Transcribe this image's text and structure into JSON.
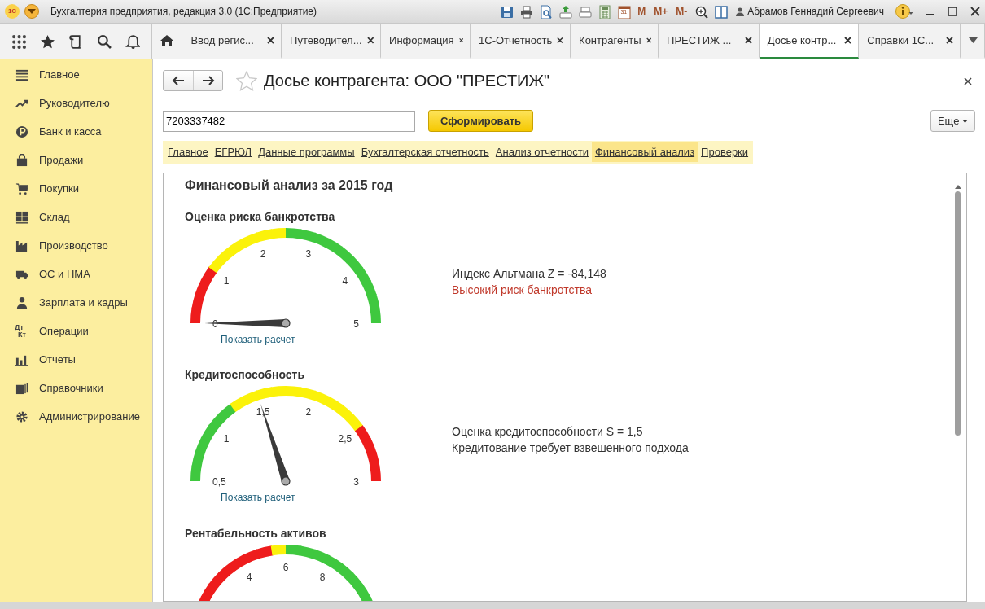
{
  "window": {
    "logo": "1С",
    "title": "Бухгалтерия предприятия, редакция 3.0  (1С:Предприятие)",
    "user": "Абрамов Геннадий Сергеевич"
  },
  "toolbar": [
    {
      "kind": "save"
    },
    {
      "kind": "print"
    },
    {
      "kind": "preview"
    },
    {
      "kind": "export"
    },
    {
      "kind": "scan"
    },
    {
      "kind": "calculator"
    },
    {
      "kind": "calendar",
      "text": "31"
    },
    {
      "kind": "memory",
      "text": "M"
    },
    {
      "kind": "memory",
      "text": "M+"
    },
    {
      "kind": "memory",
      "text": "M-"
    },
    {
      "kind": "zoom"
    },
    {
      "kind": "panel"
    }
  ],
  "section_tools": [
    {
      "kind": "apps"
    },
    {
      "kind": "star"
    },
    {
      "kind": "history"
    },
    {
      "kind": "search"
    },
    {
      "kind": "bell"
    }
  ],
  "tabs": [
    {
      "label": "Ввод регис...",
      "selected": false
    },
    {
      "label": "Путеводител...",
      "selected": false
    },
    {
      "label": "Информация",
      "selected": false
    },
    {
      "label": "1С-Отчетность",
      "selected": false
    },
    {
      "label": "Контрагенты",
      "selected": false
    },
    {
      "label": "ПРЕСТИЖ ...",
      "selected": false
    },
    {
      "label": "Досье контр...",
      "selected": true
    },
    {
      "label": "Справки 1С...",
      "selected": false
    }
  ],
  "sidebar": {
    "items": [
      {
        "label": "Главное",
        "kind": "list"
      },
      {
        "label": "Руководителю",
        "kind": "trend"
      },
      {
        "label": "Банк и касса",
        "kind": "ruble"
      },
      {
        "label": "Продажи",
        "kind": "bag"
      },
      {
        "label": "Покупки",
        "kind": "cart"
      },
      {
        "label": "Склад",
        "kind": "grid"
      },
      {
        "label": "Производство",
        "kind": "factory"
      },
      {
        "label": "ОС и НМА",
        "kind": "truck"
      },
      {
        "label": "Зарплата и кадры",
        "kind": "person"
      },
      {
        "label": "Операции",
        "kind": "dtkt",
        "icon_text": [
          "Дт",
          "Кт"
        ]
      },
      {
        "label": "Отчеты",
        "kind": "bars"
      },
      {
        "label": "Справочники",
        "kind": "books"
      },
      {
        "label": "Администрирование",
        "kind": "gear"
      }
    ]
  },
  "form": {
    "title": "Досье контрагента: ООО \"ПРЕСТИЖ\"",
    "inn": {
      "value": "7203337482"
    },
    "generate_button": "Сформировать",
    "more_button": "Еще",
    "sections": [
      {
        "label": "Главное",
        "selected": false
      },
      {
        "label": "ЕГРЮЛ",
        "selected": false
      },
      {
        "label": "Данные программы",
        "selected": false
      },
      {
        "label": "Бухгалтерская отчетность",
        "selected": false
      },
      {
        "label": "Анализ отчетности",
        "selected": false
      },
      {
        "label": "Финансовый анализ",
        "selected": true
      },
      {
        "label": "Проверки",
        "selected": false
      }
    ],
    "panel_title": "Финансовый анализ за 2015 год",
    "gauges": [
      {
        "title": "Оценка риска банкротства",
        "segments": [
          {
            "color": "#ee1c1c"
          },
          {
            "color": "#ee1c1c"
          },
          {
            "color": "#ee1c1c"
          },
          {
            "color": "#ee1c1c"
          },
          {
            "color": "#fbf20a"
          },
          {
            "color": "#fbf20a"
          },
          {
            "color": "#fbf20a"
          },
          {
            "color": "#fbf20a"
          },
          {
            "color": "#fbf20a"
          },
          {
            "color": "#fbf20a"
          },
          {
            "color": "#3fc83f"
          },
          {
            "color": "#3fc83f"
          },
          {
            "color": "#3fc83f"
          },
          {
            "color": "#3fc83f"
          },
          {
            "color": "#3fc83f"
          },
          {
            "color": "#3fc83f"
          },
          {
            "color": "#3fc83f"
          },
          {
            "color": "#3fc83f"
          },
          {
            "color": "#3fc83f"
          },
          {
            "color": "#3fc83f"
          }
        ],
        "kind": "full",
        "ticks": [
          {
            "label": "0",
            "pointed": true
          },
          {
            "label": "1",
            "pointed": false
          },
          {
            "label": "2",
            "pointed": false
          },
          {
            "label": "3",
            "pointed": false
          },
          {
            "label": "4",
            "pointed": false
          },
          {
            "label": "5",
            "pointed": false
          }
        ],
        "link": "Показать расчет",
        "lines": [
          {
            "text": "Индекс Альтмана Z = -84,148",
            "kind": "normal"
          },
          {
            "text": "Высокий риск банкротства",
            "kind": "alert"
          }
        ]
      },
      {
        "title": "Кредитоспособность",
        "segments": [
          {
            "color": "#3fc83f"
          },
          {
            "color": "#3fc83f"
          },
          {
            "color": "#3fc83f"
          },
          {
            "color": "#3fc83f"
          },
          {
            "color": "#3fc83f"
          },
          {
            "color": "#3fc83f"
          },
          {
            "color": "#fbf20a"
          },
          {
            "color": "#fbf20a"
          },
          {
            "color": "#fbf20a"
          },
          {
            "color": "#fbf20a"
          },
          {
            "color": "#fbf20a"
          },
          {
            "color": "#fbf20a"
          },
          {
            "color": "#fbf20a"
          },
          {
            "color": "#fbf20a"
          },
          {
            "color": "#fbf20a"
          },
          {
            "color": "#fbf20a"
          },
          {
            "color": "#ee1c1c"
          },
          {
            "color": "#ee1c1c"
          },
          {
            "color": "#ee1c1c"
          },
          {
            "color": "#ee1c1c"
          }
        ],
        "kind": "full",
        "ticks": [
          {
            "label": "0,5",
            "pointed": false
          },
          {
            "label": "1",
            "pointed": false
          },
          {
            "label": "1,5",
            "pointed": true
          },
          {
            "label": "2",
            "pointed": false
          },
          {
            "label": "2,5",
            "pointed": false
          },
          {
            "label": "3",
            "pointed": false
          }
        ],
        "link": "Показать расчет",
        "lines": [
          {
            "text": "Оценка кредитоспособности S = 1,5",
            "kind": "normal"
          },
          {
            "text": "Кредитование требует взвешенного подхода",
            "kind": "normal"
          }
        ]
      },
      {
        "title": "Рентабельность активов",
        "segments": [
          {
            "color": "#ee1c1c"
          },
          {
            "color": "#ee1c1c"
          },
          {
            "color": "#ee1c1c"
          },
          {
            "color": "#ee1c1c"
          },
          {
            "color": "#ee1c1c"
          },
          {
            "color": "#ee1c1c"
          },
          {
            "color": "#ee1c1c"
          },
          {
            "color": "#fbf20a"
          },
          {
            "color": "#3fc83f"
          },
          {
            "color": "#3fc83f"
          },
          {
            "color": "#3fc83f"
          },
          {
            "color": "#3fc83f"
          },
          {
            "color": "#3fc83f"
          },
          {
            "color": "#3fc83f"
          },
          {
            "color": "#3fc83f"
          },
          {
            "color": "#3fc83f"
          }
        ],
        "kind": "partial",
        "ticks": [
          {
            "label": "4",
            "pointed": false
          },
          {
            "label": "6",
            "pointed": false
          },
          {
            "label": "8",
            "pointed": false
          }
        ]
      }
    ]
  }
}
